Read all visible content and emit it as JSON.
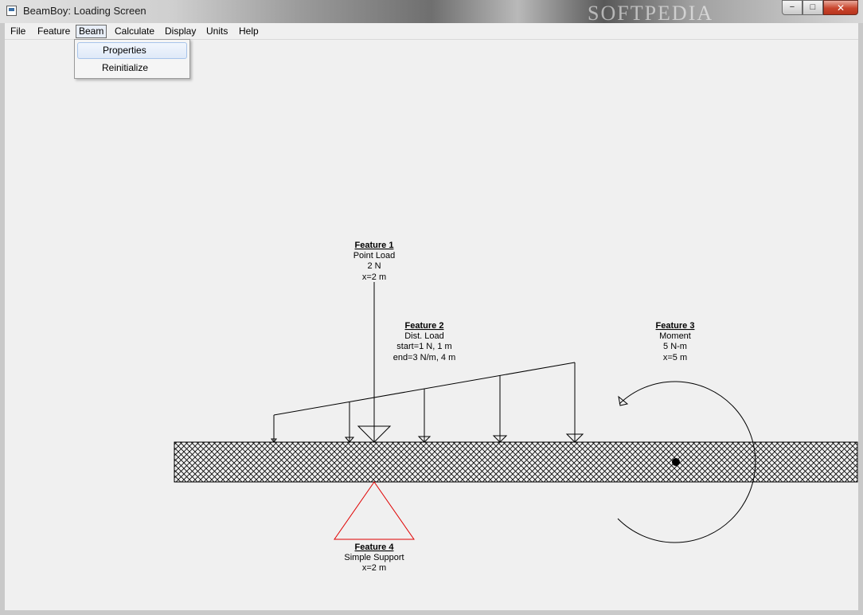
{
  "window": {
    "title": "BeamBoy: Loading Screen",
    "watermark": "SOFTPEDIA",
    "controls": {
      "minimize": "−",
      "maximize": "□",
      "close": "✕"
    }
  },
  "menubar": {
    "items": [
      "File",
      "Feature",
      "Beam",
      "Calculate",
      "Display",
      "Units",
      "Help"
    ],
    "active": "Beam"
  },
  "beam_menu": {
    "items": [
      "Properties",
      "Reinitialize"
    ],
    "highlighted": "Properties"
  },
  "features": {
    "feature1": {
      "heading": "Feature 1",
      "type": "Point Load",
      "value": "2 N",
      "position": "x=2 m"
    },
    "feature2": {
      "heading": "Feature 2",
      "type": "Dist. Load",
      "start": "start=1 N, 1 m",
      "end": "end=3 N/m, 4 m"
    },
    "feature3": {
      "heading": "Feature 3",
      "type": "Moment",
      "value": "5 N-m",
      "position": "x=5 m"
    },
    "feature4": {
      "heading": "Feature 4",
      "type": "Simple Support",
      "position": "x=2 m"
    }
  },
  "colors": {
    "support": "#e00000",
    "lines": "#000000",
    "background": "#f0f0f0"
  }
}
